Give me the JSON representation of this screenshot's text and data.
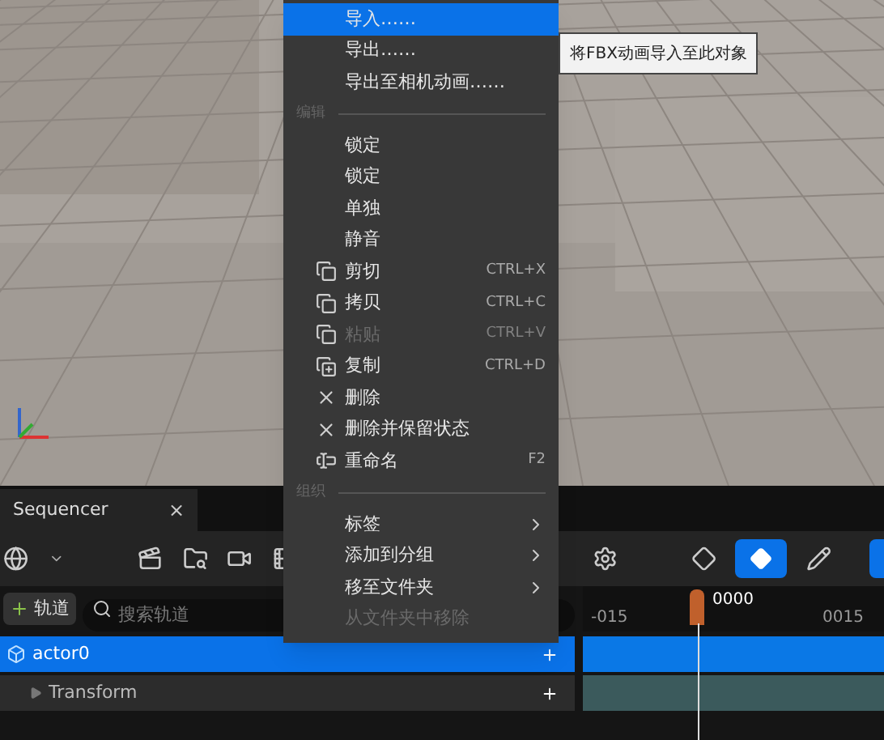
{
  "menu": {
    "items": [
      {
        "kind": "plain",
        "label": "导入……",
        "selected": true,
        "disabled": false,
        "submenu": false
      },
      {
        "kind": "plain",
        "label": "导出……",
        "selected": false,
        "disabled": false,
        "submenu": false
      },
      {
        "kind": "plain",
        "label": "导出至相机动画……",
        "selected": false,
        "disabled": false,
        "submenu": false
      },
      {
        "kind": "header",
        "label": "编辑"
      },
      {
        "kind": "plain",
        "label": "锁定",
        "selected": false,
        "disabled": false,
        "submenu": false
      },
      {
        "kind": "plain",
        "label": "锁定",
        "selected": false,
        "disabled": false,
        "submenu": false
      },
      {
        "kind": "plain",
        "label": "单独",
        "selected": false,
        "disabled": false,
        "submenu": false
      },
      {
        "kind": "plain",
        "label": "静音",
        "selected": false,
        "disabled": false,
        "submenu": false
      },
      {
        "kind": "squares",
        "label": "剪切",
        "shortcut": "CTRL+X",
        "selected": false,
        "disabled": false,
        "submenu": false
      },
      {
        "kind": "squares",
        "label": "拷贝",
        "shortcut": "CTRL+C",
        "selected": false,
        "disabled": false,
        "submenu": false
      },
      {
        "kind": "squares",
        "label": "粘贴",
        "shortcut": "CTRL+V",
        "selected": false,
        "disabled": true,
        "submenu": false
      },
      {
        "kind": "squares-plus",
        "label": "复制",
        "shortcut": "CTRL+D",
        "selected": false,
        "disabled": false,
        "submenu": false
      },
      {
        "kind": "cross",
        "label": "删除",
        "selected": false,
        "disabled": false,
        "submenu": false
      },
      {
        "kind": "cross",
        "label": "删除并保留状态",
        "selected": false,
        "disabled": false,
        "submenu": false
      },
      {
        "kind": "rename",
        "label": "重命名",
        "shortcut": "F2",
        "selected": false,
        "disabled": false,
        "submenu": false
      },
      {
        "kind": "header",
        "label": "组织"
      },
      {
        "kind": "plain",
        "label": "标签",
        "selected": false,
        "disabled": false,
        "submenu": true
      },
      {
        "kind": "plain",
        "label": "添加到分组",
        "selected": false,
        "disabled": false,
        "submenu": true
      },
      {
        "kind": "plain",
        "label": "移至文件夹",
        "selected": false,
        "disabled": false,
        "submenu": true
      },
      {
        "kind": "plain",
        "label": "从文件夹中移除",
        "selected": false,
        "disabled": true,
        "submenu": false
      }
    ]
  },
  "tooltip": "将FBX动画导入至此对象",
  "sequencer": {
    "tab": {
      "label": "Sequencer",
      "close": "×"
    },
    "add_track": "轨道",
    "search": {
      "placeholder": "搜索轨道"
    },
    "key_button": {
      "selected": true
    },
    "timeline": {
      "current": "0000",
      "ticks": [
        "-015",
        "0015"
      ]
    },
    "tracks": [
      {
        "label": "actor0",
        "selected": true
      },
      {
        "label": "Transform",
        "selected": false
      }
    ]
  }
}
